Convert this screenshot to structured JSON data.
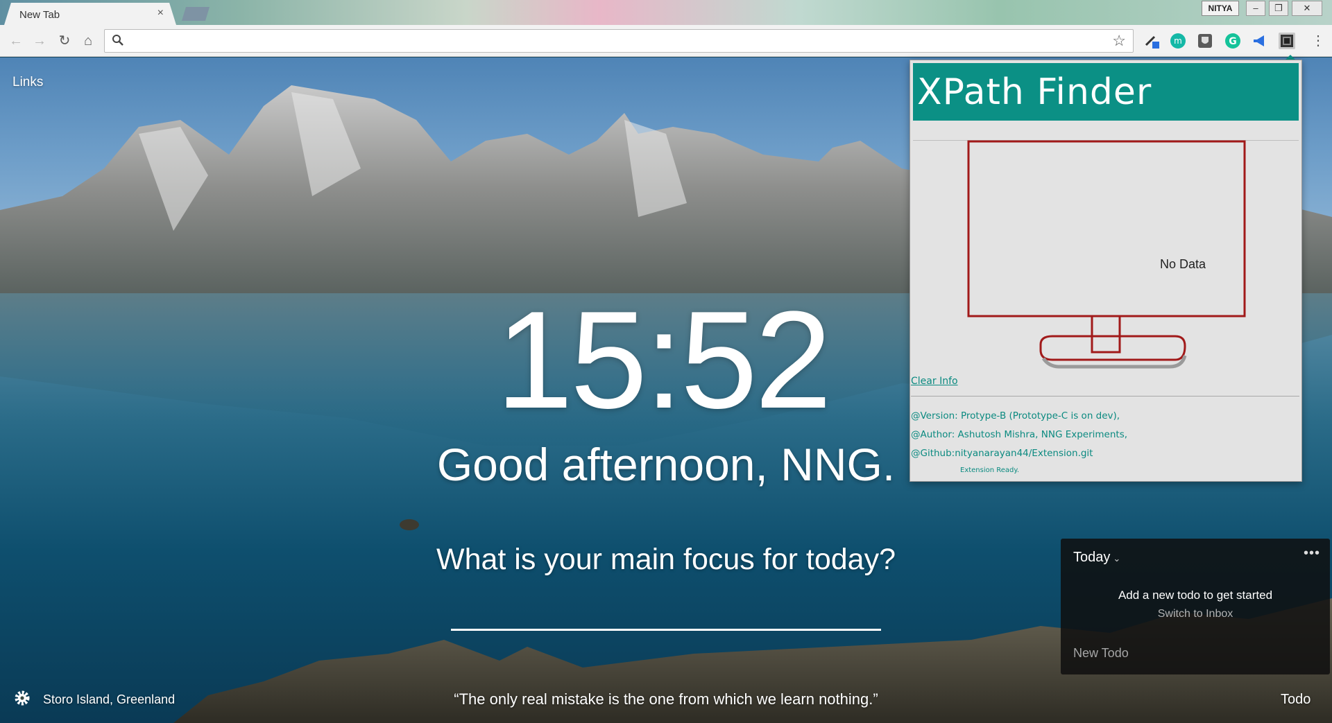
{
  "browser": {
    "tab_title": "New Tab",
    "tab_close": "×",
    "profile_name": "NITYA",
    "window_controls": [
      "minimize",
      "restore",
      "close"
    ],
    "omnibox_value": "",
    "extensions": [
      "color-picker-extension",
      "m-extension",
      "shield-extension",
      "grammarly-extension",
      "megaphone-extension",
      "xpath-finder-extension"
    ]
  },
  "momentum": {
    "links_label": "Links",
    "time": "15:52",
    "greeting": "Good afternoon, NNG.",
    "focus_question": "What is your main focus for today?",
    "focus_value": "",
    "location": "Storo Island, Greenland",
    "quote": "“The only real mistake is the one from which we learn nothing.”",
    "todo_link": "Todo"
  },
  "todo": {
    "list_name": "Today",
    "more": "•••",
    "empty_message": "Add a new todo to get started",
    "switch_label": "Switch to Inbox",
    "new_placeholder": "New Todo"
  },
  "xpath_popup": {
    "title": "XPath Finder",
    "no_data": "No Data",
    "clear_info": "Clear Info",
    "version": "@Version: Protype-B (Prototype-C is on dev),",
    "author": "@Author: Ashutosh Mishra,   NNG Experiments,",
    "github": "@Github:nityanarayan44/Extension.git",
    "status": "Extension Ready."
  },
  "colors": {
    "xpath_teal": "#0b9085",
    "monitor_red": "#a11a1a",
    "todo_panel": "#0f0f0f"
  }
}
